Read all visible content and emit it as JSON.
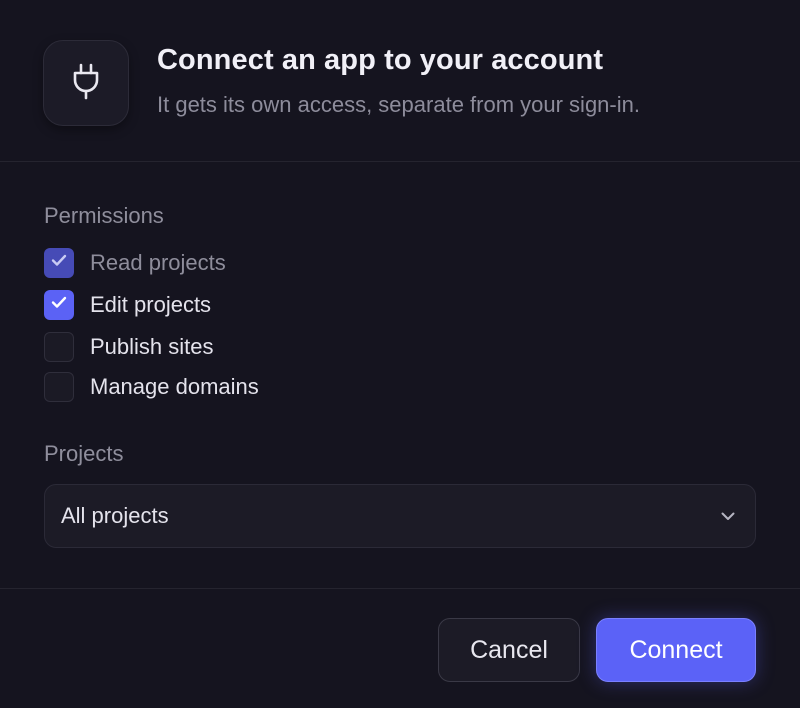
{
  "header": {
    "title": "Connect an app to your account",
    "subtitle": "It gets its own access, separate from your sign-in.",
    "icon": "plug-icon"
  },
  "permissions": {
    "label": "Permissions",
    "items": [
      {
        "label": "Read projects",
        "checked": true,
        "disabled": true
      },
      {
        "label": "Edit projects",
        "checked": true,
        "disabled": false
      },
      {
        "label": "Publish sites",
        "checked": false,
        "disabled": false
      },
      {
        "label": "Manage domains",
        "checked": false,
        "disabled": false
      }
    ]
  },
  "projects": {
    "label": "Projects",
    "selected": "All projects"
  },
  "footer": {
    "cancel_label": "Cancel",
    "connect_label": "Connect"
  },
  "colors": {
    "accent": "#5b62f7",
    "background": "#15141f"
  }
}
